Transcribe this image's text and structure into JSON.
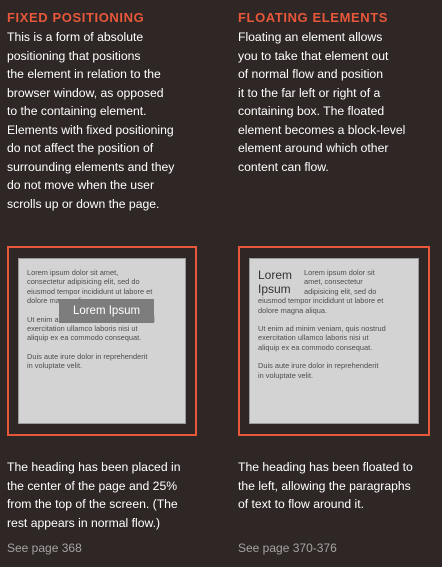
{
  "left": {
    "heading": "FIXED POSITIONING",
    "description": [
      "This is a form of absolute",
      "positioning that positions",
      "the element in relation to the",
      "browser window, as opposed",
      "to the containing element.",
      "Elements with fixed positioning",
      "do not affect the position of",
      "surrounding elements and they",
      "do not move when the user",
      "scrolls up or down the page."
    ],
    "example": {
      "heading": "Lorem Ipsum",
      "paragraphs": [
        [
          "Lorem ipsum dolor sit amet,",
          "consectetur adipisicing elit, sed do",
          "eiusmod tempor incididunt ut labore et",
          "dolore magna aliqua."
        ],
        [
          "Ut enim ad minim veniam, quis nostrud",
          "exercitation ullamco laboris nisi ut",
          "aliquip ex ea commodo consequat."
        ],
        [
          "Duis aute irure dolor in reprehenderit",
          "in voluptate velit."
        ]
      ]
    },
    "caption": [
      "The heading has been placed in",
      "the center of the page and 25%",
      "from the top of the screen. (The",
      "rest appears in normal flow.)"
    ],
    "reference": "See page 368"
  },
  "right": {
    "heading": "FLOATING ELEMENTS",
    "description": [
      "Floating an element allows",
      "you to take that element out",
      "of normal flow and position",
      "it to the far left or right of a",
      "containing box. The floated",
      "element becomes a block-level",
      "element around which other",
      "content can flow."
    ],
    "example": {
      "heading": "Lorem Ipsum",
      "paragraphs": [
        [
          "Lorem ipsum dolor sit",
          "amet, consectetur",
          "adipisicing elit, sed do",
          "eiusmod tempor incididunt ut labore et",
          "dolore magna aliqua."
        ],
        [
          "Ut enim ad minim veniam, quis nostrud",
          "exercitation ullamco laboris nisi ut",
          "aliquip ex ea commodo consequat."
        ],
        [
          "Duis aute irure dolor in reprehenderit",
          "in voluptate velit."
        ]
      ]
    },
    "caption": [
      "The heading has been floated to",
      "the left, allowing the paragraphs",
      "of text to flow around it."
    ],
    "reference": "See page 370-376"
  },
  "colors": {
    "background": "#2e2726",
    "accent": "#e8573a",
    "text": "#ffffff",
    "muted": "#a7a3a2",
    "page": "#d3d3d3",
    "page_text": "#4d4d4d",
    "fixed_box": "#7d7d7d"
  }
}
